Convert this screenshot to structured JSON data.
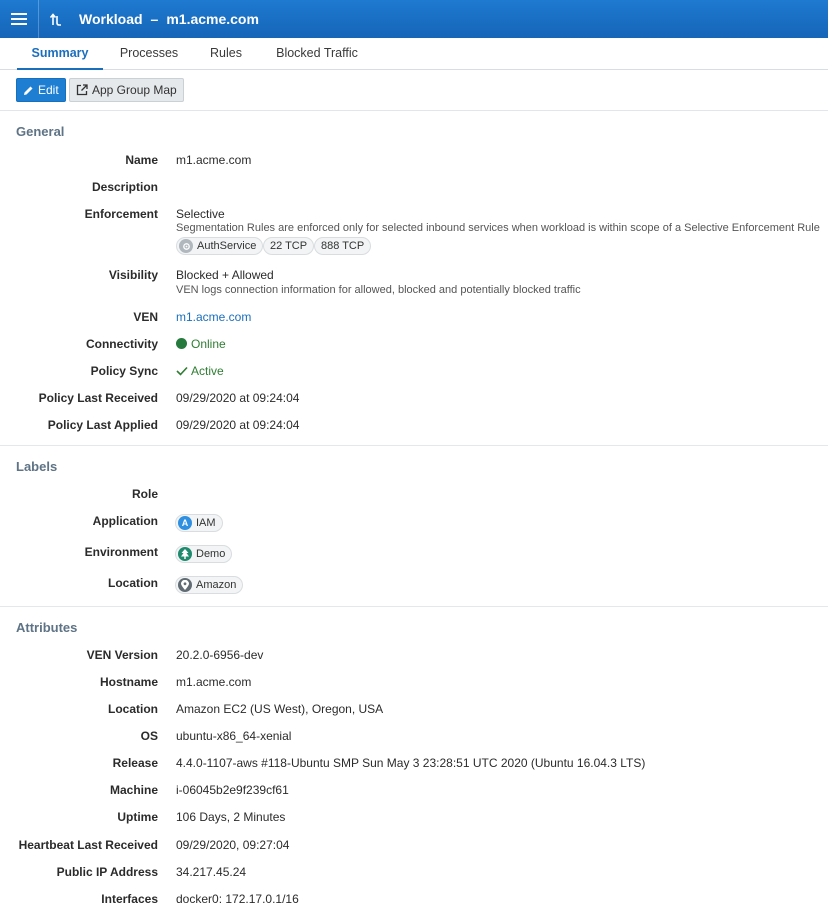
{
  "header": {
    "page_type": "Workload",
    "separator": "–",
    "workload_name": "m1.acme.com"
  },
  "tabs": [
    {
      "label": "Summary",
      "active": true
    },
    {
      "label": "Processes",
      "active": false
    },
    {
      "label": "Rules",
      "active": false
    },
    {
      "label": "Blocked Traffic",
      "active": false
    }
  ],
  "toolbar": {
    "edit_label": "Edit",
    "app_group_map_label": "App Group Map"
  },
  "general": {
    "title": "General",
    "name": {
      "label": "Name",
      "value": "m1.acme.com"
    },
    "description": {
      "label": "Description",
      "value": ""
    },
    "enforcement": {
      "label": "Enforcement",
      "value": "Selective",
      "note": "Segmentation Rules are enforced only for selected inbound services when workload is within scope of a Selective Enforcement Rule",
      "services": [
        {
          "label": "AuthService",
          "icon": "service-icon"
        },
        {
          "label": "22 TCP"
        },
        {
          "label": "888 TCP"
        }
      ]
    },
    "visibility": {
      "label": "Visibility",
      "value": "Blocked + Allowed",
      "note": "VEN logs connection information for allowed, blocked and potentially blocked traffic"
    },
    "ven": {
      "label": "VEN",
      "value": "m1.acme.com"
    },
    "connectivity": {
      "label": "Connectivity",
      "value": "Online",
      "color": "#267a3e"
    },
    "policy_sync": {
      "label": "Policy Sync",
      "value": "Active",
      "color": "#2e7d32"
    },
    "policy_last_received": {
      "label": "Policy Last Received",
      "value": "09/29/2020 at 09:24:04"
    },
    "policy_last_applied": {
      "label": "Policy Last Applied",
      "value": "09/29/2020 at 09:24:04"
    }
  },
  "labels": {
    "title": "Labels",
    "role": {
      "label": "Role",
      "value": ""
    },
    "application": {
      "label": "Application",
      "value": "IAM",
      "icon": "application-label-icon",
      "icon_letter": "A"
    },
    "environment": {
      "label": "Environment",
      "value": "Demo",
      "icon": "environment-label-icon"
    },
    "location": {
      "label": "Location",
      "value": "Amazon",
      "icon": "location-pin-icon"
    }
  },
  "attributes": {
    "title": "Attributes",
    "ven_version": {
      "label": "VEN Version",
      "value": "20.2.0-6956-dev"
    },
    "hostname": {
      "label": "Hostname",
      "value": "m1.acme.com"
    },
    "location": {
      "label": "Location",
      "value": "Amazon EC2 (US West), Oregon, USA"
    },
    "os": {
      "label": "OS",
      "value": "ubuntu-x86_64-xenial"
    },
    "release": {
      "label": "Release",
      "value": "4.4.0-1107-aws #118-Ubuntu SMP Sun May 3 23:28:51 UTC 2020 (Ubuntu 16.04.3 LTS)"
    },
    "machine": {
      "label": "Machine",
      "value": "i-06045b2e9f239cf61"
    },
    "uptime": {
      "label": "Uptime",
      "value": "106 Days, 2 Minutes"
    },
    "heartbeat": {
      "label": "Heartbeat Last Received",
      "value": "09/29/2020, 09:27:04"
    },
    "public_ip": {
      "label": "Public IP Address",
      "value": "34.217.45.24"
    },
    "interfaces": {
      "label": "Interfaces",
      "value": "docker0: 172.17.0.1/16"
    }
  },
  "colors": {
    "brand": "#1a73c8",
    "link": "#1a6fbd",
    "section_title": "#5e7385"
  }
}
